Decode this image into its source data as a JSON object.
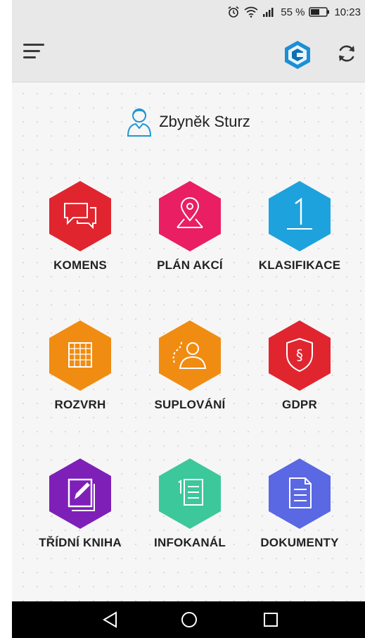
{
  "status_bar": {
    "battery_percent_text": "55 %",
    "time": "10:23",
    "icons": [
      "alarm-icon",
      "wifi-icon",
      "signal-icon",
      "battery-icon"
    ]
  },
  "app_bar": {
    "icons": [
      "menu-icon",
      "bakalari-logo-icon",
      "refresh-icon"
    ]
  },
  "user": {
    "name": "Zbyněk Sturz",
    "icon": "user-avatar-icon"
  },
  "tiles": [
    {
      "label": "KOMENS",
      "color": "#e0252f",
      "icon": "chat-bubbles-icon"
    },
    {
      "label": "PLÁN AKCÍ",
      "color": "#e91e63",
      "icon": "map-pin-icon"
    },
    {
      "label": "KLASIFIKACE",
      "color": "#1ea2dd",
      "icon": "grade-one-icon"
    },
    {
      "label": "ROZVRH",
      "color": "#f08c12",
      "icon": "timetable-grid-icon"
    },
    {
      "label": "SUPLOVÁNÍ",
      "color": "#f08c12",
      "icon": "substitute-person-icon"
    },
    {
      "label": "GDPR",
      "color": "#e0252f",
      "icon": "shield-paragraph-icon"
    },
    {
      "label": "TŘÍDNÍ KNIHA",
      "color": "#7e20b8",
      "icon": "class-book-pen-icon"
    },
    {
      "label": "INFOKANÁL",
      "color": "#3cc89a",
      "icon": "numbered-list-icon"
    },
    {
      "label": "DOKUMENTY",
      "color": "#5a68e3",
      "icon": "document-icon"
    }
  ],
  "nav_bar": {
    "icons": [
      "back-icon",
      "home-icon",
      "recents-icon"
    ]
  }
}
